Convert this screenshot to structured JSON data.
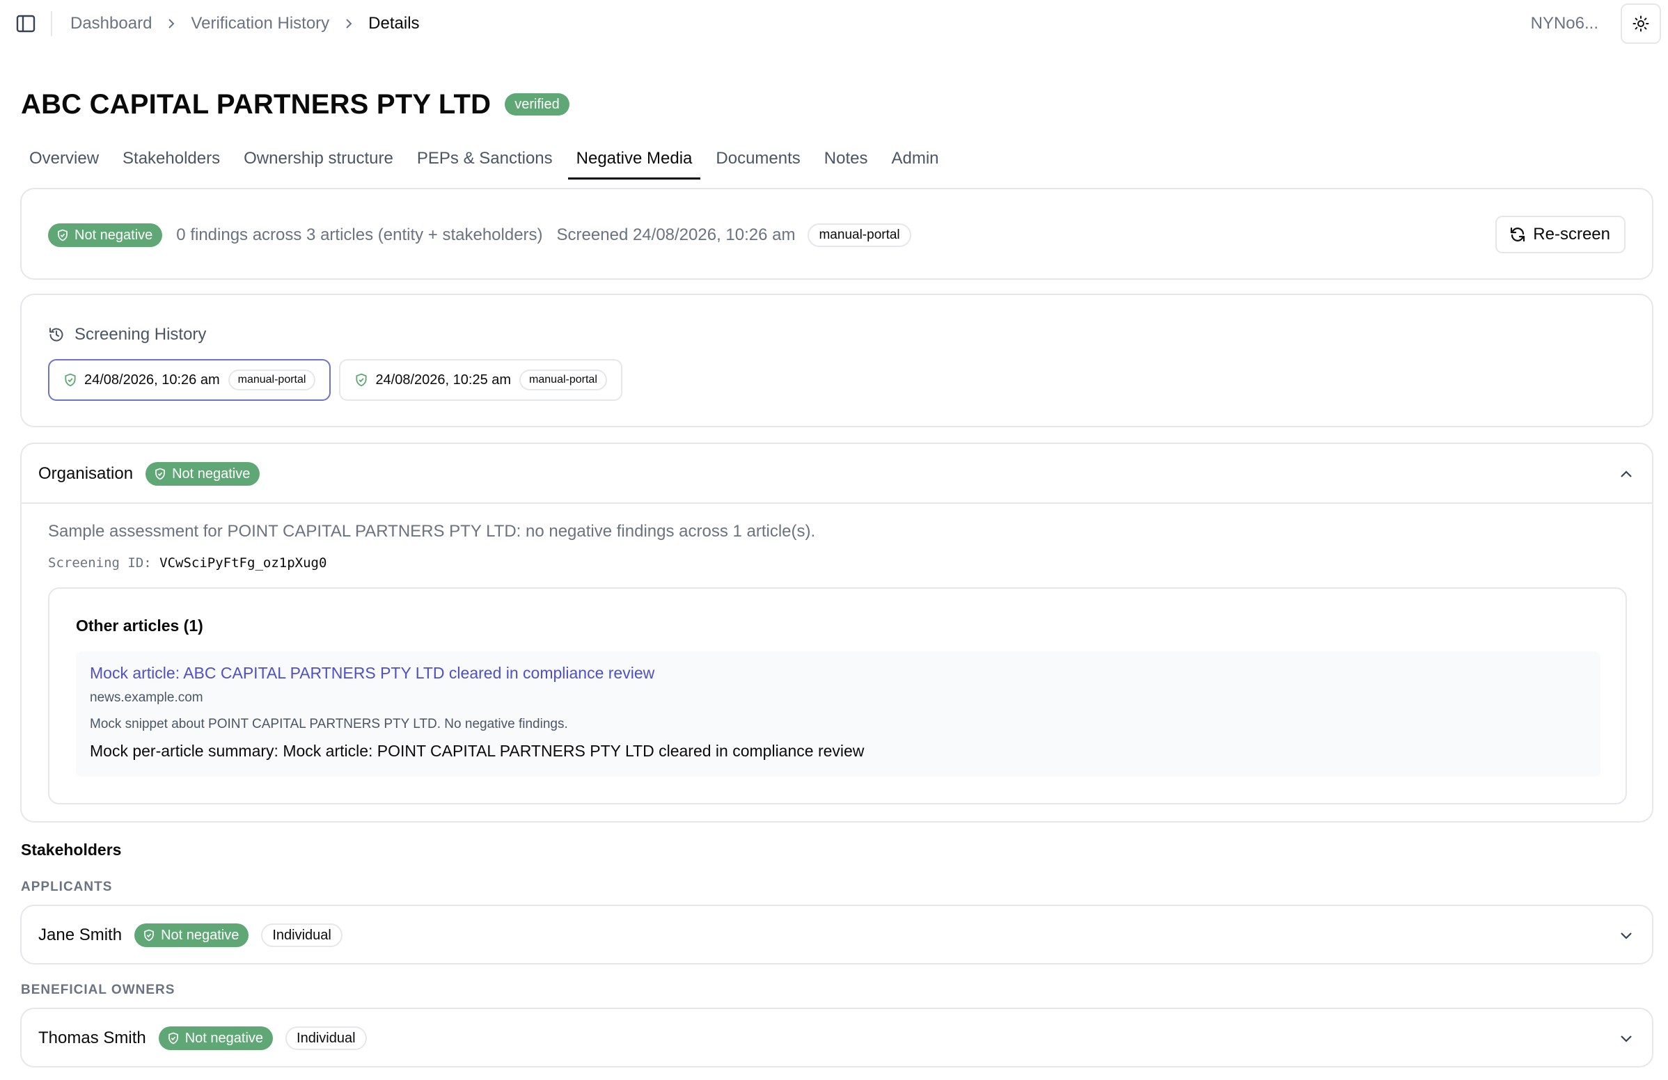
{
  "breadcrumb": {
    "items": [
      "Dashboard",
      "Verification History"
    ],
    "current": "Details"
  },
  "user": {
    "id": "NYNo6..."
  },
  "company": {
    "name": "ABC CAPITAL PARTNERS PTY LTD",
    "status": "verified"
  },
  "tabs": [
    "Overview",
    "Stakeholders",
    "Ownership structure",
    "PEPs & Sanctions",
    "Negative Media",
    "Documents",
    "Notes",
    "Admin"
  ],
  "active_tab": "Negative Media",
  "summary": {
    "status": "Not negative",
    "findings": "0 findings across 3 articles (entity + stakeholders)",
    "screened": "Screened 24/08/2026, 10:26 am",
    "source": "manual-portal",
    "rescreen_label": "Re-screen"
  },
  "history": {
    "title": "Screening History",
    "entries": [
      {
        "datetime": "24/08/2026, 10:26 am",
        "source": "manual-portal",
        "selected": true
      },
      {
        "datetime": "24/08/2026, 10:25 am",
        "source": "manual-portal",
        "selected": false
      }
    ]
  },
  "organisation": {
    "label": "Organisation",
    "status": "Not negative",
    "assessment": "Sample assessment for POINT CAPITAL PARTNERS PTY LTD: no negative findings across 1 article(s).",
    "screening_id_label": "Screening ID:",
    "screening_id": "VCwSciPyFtFg_oz1pXug0",
    "other_articles_title": "Other articles (1)",
    "article": {
      "title": "Mock article: ABC CAPITAL PARTNERS PTY LTD cleared in compliance review",
      "domain": "news.example.com",
      "snippet": "Mock snippet about POINT CAPITAL PARTNERS PTY LTD. No negative findings.",
      "summary": "Mock per-article summary: Mock article: POINT CAPITAL PARTNERS PTY LTD cleared in compliance review"
    }
  },
  "stakeholders": {
    "title": "Stakeholders",
    "groups": [
      {
        "label": "APPLICANTS",
        "people": [
          {
            "name": "Jane Smith",
            "status": "Not negative",
            "type": "Individual"
          }
        ]
      },
      {
        "label": "BENEFICIAL OWNERS",
        "people": [
          {
            "name": "Thomas Smith",
            "status": "Not negative",
            "type": "Individual"
          }
        ]
      }
    ]
  },
  "colors": {
    "status_green": "#5fa876",
    "link": "#4f4fc8",
    "selected_border": "#6d74c8",
    "muted_text": "#6b7280"
  },
  "icons": [
    "sidebar-toggle-icon",
    "chevron-right-icon",
    "sun-icon",
    "shield-check-icon",
    "refresh-icon",
    "history-icon",
    "chevron-up-icon",
    "chevron-down-icon"
  ]
}
